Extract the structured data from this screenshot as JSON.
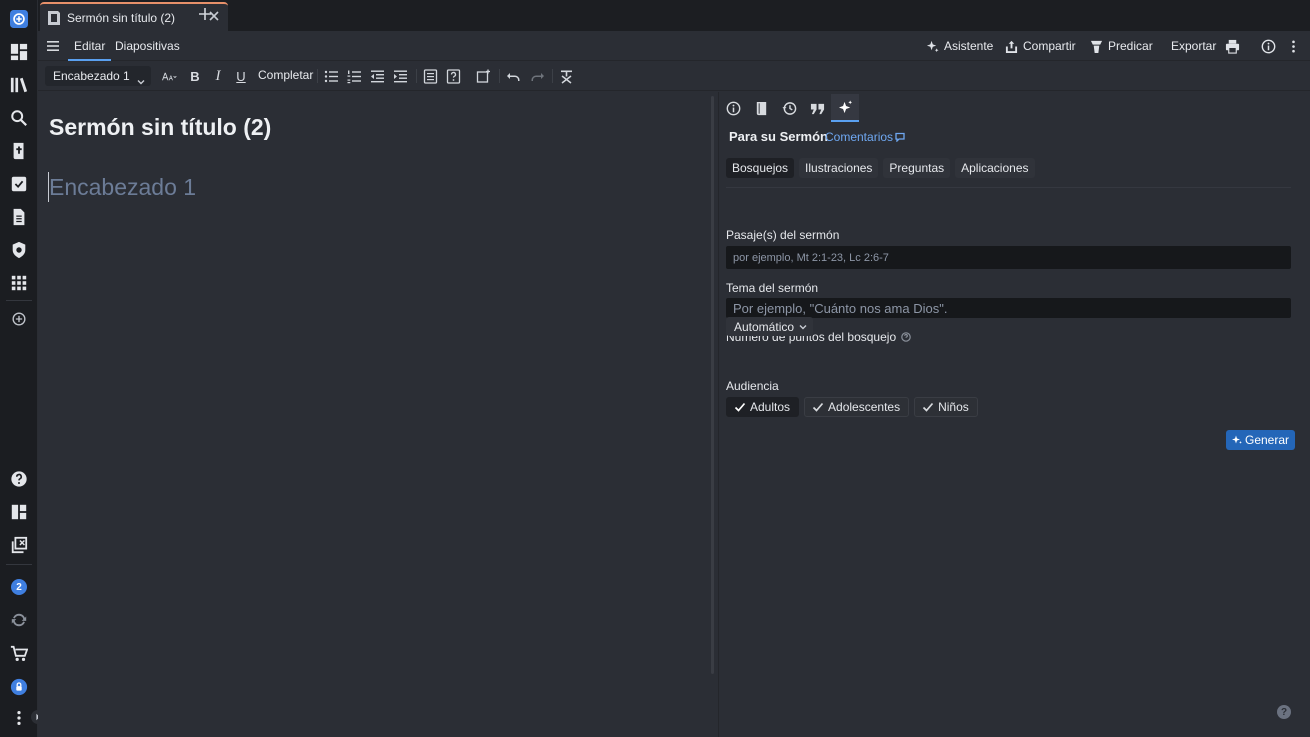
{
  "tab": {
    "title": "Sermón sin título (2)"
  },
  "menu": {
    "edit": "Editar",
    "slides": "Diapositivas",
    "assistant": "Asistente",
    "share": "Compartir",
    "preach": "Predicar",
    "export": "Exportar"
  },
  "toolbar": {
    "style": "Encabezado 1",
    "complete": "Completar"
  },
  "editor": {
    "title": "Sermón sin título (2)",
    "placeholder": "Encabezado 1"
  },
  "panel": {
    "title": "Para su Sermón",
    "comments": "Comentarios",
    "subtabs": [
      "Bosquejos",
      "Ilustraciones",
      "Preguntas",
      "Aplicaciones"
    ],
    "active_subtab": "Bosquejos",
    "passage_label": "Pasaje(s) del sermón",
    "passage_placeholder": "por ejemplo, Mt 2:1-23, Lc 2:6-7",
    "topic_label": "Tema del sermón",
    "topic_placeholder": "Por ejemplo, \"Cuánto nos ama Dios\".",
    "points_label": "Número de puntos del bosquejo",
    "points_value": "Automático",
    "audience_label": "Audiencia",
    "audience": [
      {
        "label": "Adultos",
        "selected": true
      },
      {
        "label": "Adolescentes",
        "selected": false
      },
      {
        "label": "Niños",
        "selected": false
      }
    ],
    "generate": "Generar"
  },
  "sidebar": {
    "notification_count": "2"
  },
  "colors": {
    "accent": "#5aa0f0",
    "tab_accent": "#e7906a",
    "primary_button": "#2466b8"
  }
}
